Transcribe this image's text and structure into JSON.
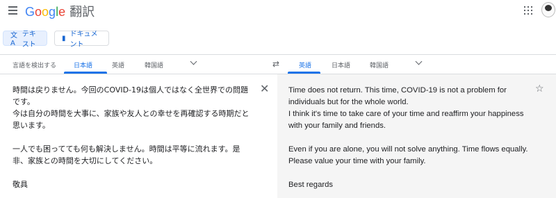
{
  "header": {
    "logo_letters": [
      "G",
      "o",
      "o",
      "g",
      "l",
      "e"
    ],
    "product": "翻訳"
  },
  "modes": {
    "text_label": "テキスト",
    "document_label": "ドキュメント"
  },
  "source": {
    "tabs": [
      "言語を検出する",
      "日本語",
      "英語",
      "韓国語"
    ],
    "active_tab": "日本語",
    "text": "時間は戻りません。今回のCOVID-19は個人ではなく全世界での問題です。\n今は自分の時間を大事に、家族や友人との幸せを再確認する時期だと思います。\n\n一人でも困ってても何も解決しません。時間は平等に流れます。是非、家族との時間を大切にしてください。\n\n敬具"
  },
  "swap_icon": "⇄",
  "target": {
    "tabs": [
      "英語",
      "日本語",
      "韓国語"
    ],
    "active_tab": "英語",
    "text": "Time does not return. This time, COVID-19 is not a problem for individuals but for the whole world.\nI think it's time to take care of your time and reaffirm your happiness with your family and friends.\n\nEven if you are alone, you will not solve anything. Time flows equally. Please value your time with your family.\n\nBest regards"
  },
  "colors": {
    "accent": "#1a73e8",
    "target_bg": "#f5f5f5"
  }
}
